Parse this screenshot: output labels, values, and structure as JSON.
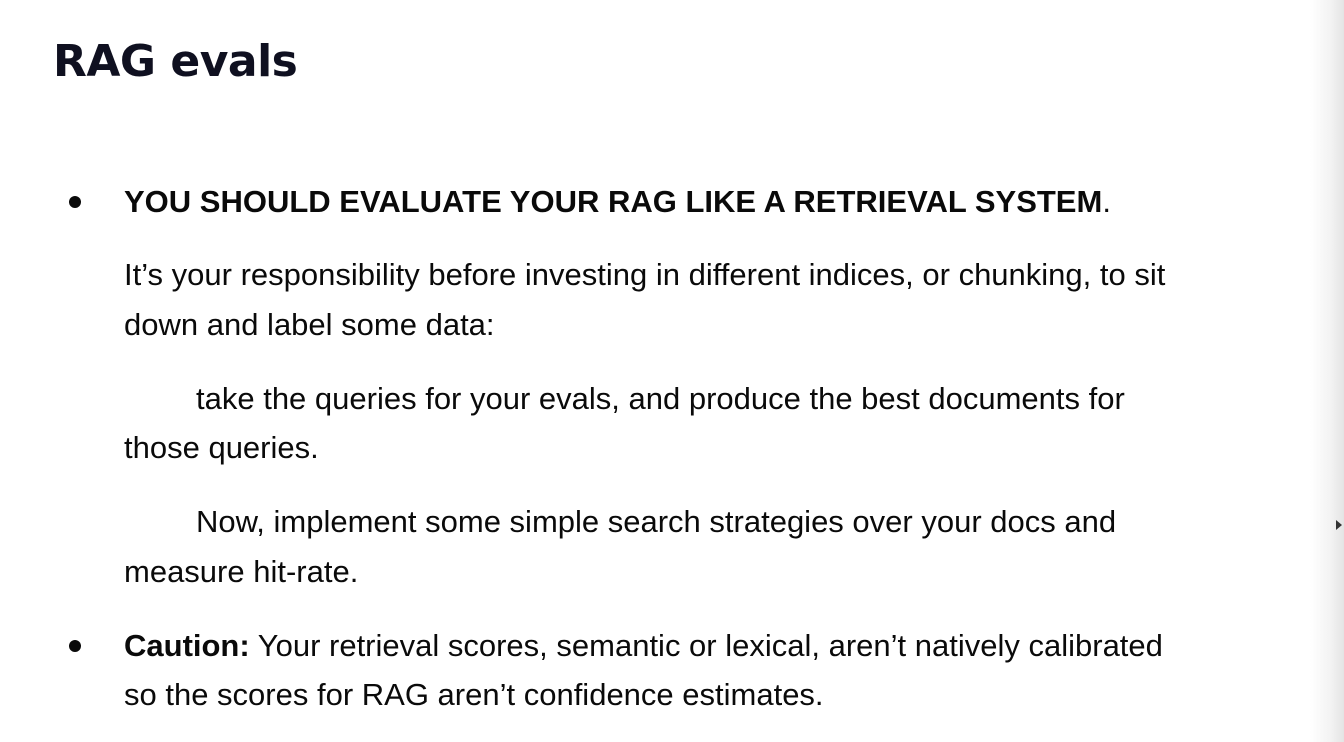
{
  "title": "RAG evals",
  "bullets": [
    {
      "heading": "YOU SHOULD EVALUATE YOUR RAG LIKE A RETRIEVAL SYSTEM",
      "heading_suffix": ".",
      "para1_line1": "It’s your responsibility before investing in different indices, or chunking, to sit",
      "para1_line2": "down and label some data:",
      "para2_line1": "take the queries for your evals, and produce the best documents for",
      "para2_line2": "those queries.",
      "para3_line1": "Now, implement some simple search strategies over your docs and",
      "para3_line2": "measure hit-rate."
    },
    {
      "label": "Caution:",
      "line1": " Your retrieval scores, semantic or lexical, aren’t natively calibrated",
      "line2": "so the scores for RAG aren’t confidence estimates."
    }
  ]
}
